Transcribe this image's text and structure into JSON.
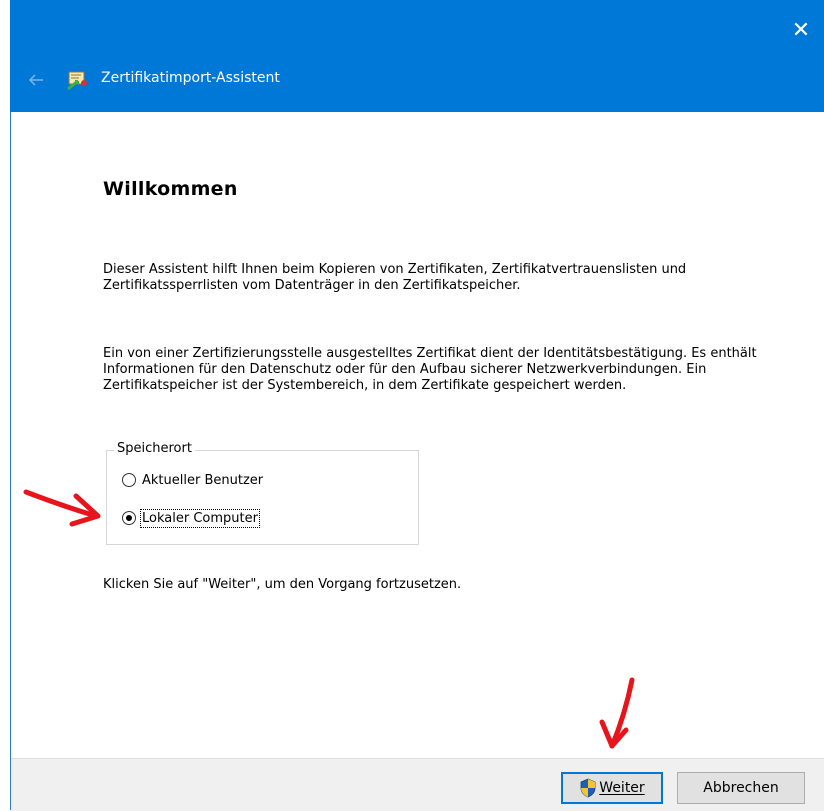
{
  "window": {
    "title": "Zertifikatimport-Assistent",
    "close_glyph": "✕",
    "accent_color": "#0078d7"
  },
  "content": {
    "heading": "Willkommen",
    "paragraph1": "Dieser Assistent hilft Ihnen beim Kopieren von Zertifikaten, Zertifikatvertrauenslisten und Zertifikatssperrlisten vom Datenträger in den Zertifikatspeicher.",
    "paragraph2": "Ein von einer Zertifizierungsstelle ausgestelltes Zertifikat dient der Identitätsbestätigung. Es enthält Informationen für den Datenschutz oder für den Aufbau sicherer Netzwerkverbindungen. Ein Zertifikatspeicher ist der Systembereich, in dem Zertifikate gespeichert werden.",
    "store_location": {
      "legend": "Speicherort",
      "options": [
        {
          "label": "Aktueller Benutzer",
          "checked": false
        },
        {
          "label": "Lokaler Computer",
          "checked": true
        }
      ]
    },
    "continue_hint": "Klicken Sie auf \"Weiter\", um den Vorgang fortzusetzen."
  },
  "footer": {
    "next_label": "Weiter",
    "cancel_label": "Abbrechen"
  },
  "icons": {
    "back": "back-arrow-icon",
    "app": "certificate-icon",
    "shield": "uac-shield-icon"
  },
  "annotation_color": "#e8141c"
}
